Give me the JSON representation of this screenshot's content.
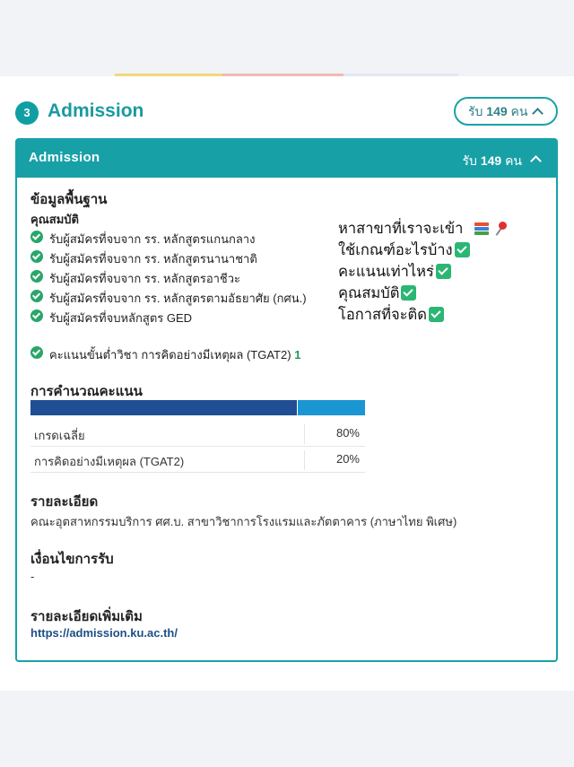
{
  "section": {
    "number": "3",
    "title": "Admission",
    "pill_prefix": "รับ",
    "pill_count": "149",
    "pill_suffix": "คน"
  },
  "card": {
    "header_title": "Admission",
    "header_prefix": "รับ",
    "header_count": "149",
    "header_suffix": "คน",
    "basic_info_heading": "ข้อมูลพื้นฐาน",
    "qualification_heading": "คุณสมบัติ",
    "qualifications": [
      "รับผู้สมัครที่จบจาก รร. หลักสูตรแกนกลาง",
      "รับผู้สมัครที่จบจาก รร. หลักสูตรนานาชาติ",
      "รับผู้สมัครที่จบจาก รร. หลักสูตรอาชีวะ",
      "รับผู้สมัครที่จบจาก รร. หลักสูตรตามอัธยาศัย (กศน.)",
      "รับผู้สมัครที่จบหลักสูตร GED"
    ],
    "min_score_label": "คะแนนขั้นต่ำวิชา การคิดอย่างมีเหตุผล (TGAT2)",
    "min_score_value": "1",
    "calc_heading": "การคำนวณคะแนน",
    "weights": [
      {
        "label": "เกรดเฉลี่ย",
        "value": "80%",
        "fraction": 0.8,
        "color": "#1f4e95"
      },
      {
        "label": "การคิดอย่างมีเหตุผล (TGAT2)",
        "value": "20%",
        "fraction": 0.2,
        "color": "#1a96d2"
      }
    ],
    "details_heading": "รายละเอียด",
    "details_text": "คณะอุตสาหกรรมบริการ ศศ.บ. สาขาวิชาการโรงแรมและภัตตาคาร (ภาษาไทย พิเศษ)",
    "conditions_heading": "เงื่อนไขการรับ",
    "conditions_text": "-",
    "more_heading": "รายละเอียดเพิ่มเติม",
    "more_link": "https://admission.ku.ac.th/"
  },
  "overlay": {
    "lines": [
      "หาสาขาที่เราจะเข้า",
      "ใช้เกณฑ์อะไรบ้าง",
      "คะแนนเท่าไหร่",
      "คุณสมบัติ",
      "โอกาสที่จะติด"
    ],
    "line1_icons": [
      "books-icon",
      "pushpin-icon"
    ],
    "check_icon": "check-mark-button-icon"
  },
  "colors": {
    "accent": "#17a0a6",
    "check_green": "#2aa66a",
    "link": "#1d4f86"
  }
}
